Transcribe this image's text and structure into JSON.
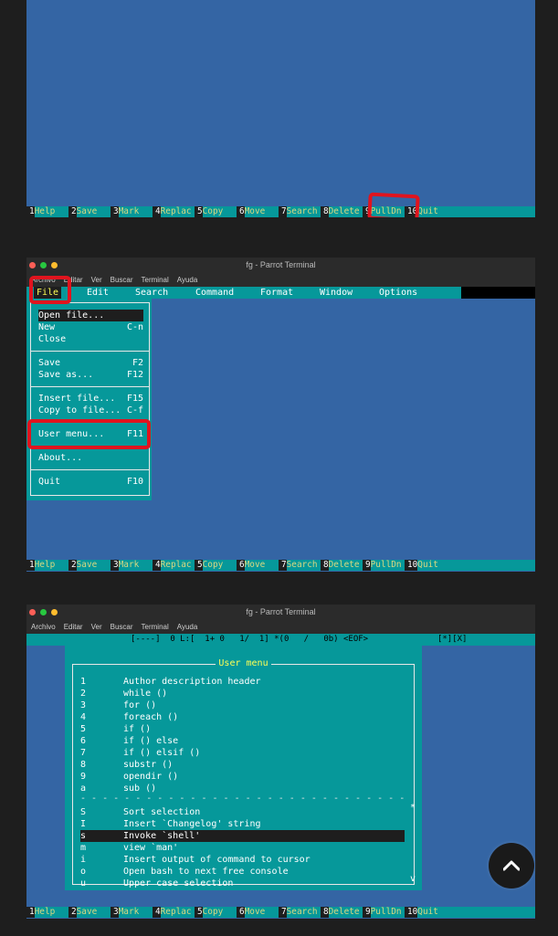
{
  "fkeys": [
    {
      "num": "1",
      "label": "Help"
    },
    {
      "num": "2",
      "label": "Save"
    },
    {
      "num": "3",
      "label": "Mark"
    },
    {
      "num": "4",
      "label": "Replac"
    },
    {
      "num": "5",
      "label": "Copy"
    },
    {
      "num": "6",
      "label": "Move"
    },
    {
      "num": "7",
      "label": "Search"
    },
    {
      "num": "8",
      "label": "Delete"
    },
    {
      "num": "9",
      "label": "PullDn"
    },
    {
      "num": "10",
      "label": "Quit"
    }
  ],
  "window": {
    "title": "fg - Parrot Terminal",
    "dot_colors": [
      "#ff5f57",
      "#28c840",
      "#febc2e"
    ],
    "menus_panel2": [
      "Archivo",
      "Editar",
      "Ver",
      "Buscar",
      "Terminal",
      "Ayuda"
    ],
    "menus_panel3": [
      "Archivo",
      "Editar",
      "Ver",
      "Buscar",
      "Terminal",
      "Ayuda"
    ]
  },
  "mc_menubar": {
    "items": [
      "File",
      "Edit",
      "Search",
      "Command",
      "Format",
      "Window",
      "Options"
    ]
  },
  "file_menu": {
    "items": [
      {
        "label": "Open file...",
        "key": ""
      },
      {
        "label": "New",
        "key": "C-n"
      },
      {
        "label": "Close",
        "key": ""
      },
      {
        "label": "Save",
        "key": "F2"
      },
      {
        "label": "Save as...",
        "key": "F12"
      },
      {
        "label": "Insert file...",
        "key": "F15"
      },
      {
        "label": "Copy to file...",
        "key": "C-f"
      },
      {
        "label": "User menu...",
        "key": "F11"
      },
      {
        "label": "About...",
        "key": ""
      },
      {
        "label": "Quit",
        "key": "F10"
      }
    ]
  },
  "editor_status": "[----]  0 L:[  1+ 0   1/  1] *(0   /   0b) <EOF>              [*][X]",
  "user_menu": {
    "title": "User menu",
    "items": [
      {
        "key": "1",
        "desc": "Author description header"
      },
      {
        "key": "2",
        "desc": "while ()"
      },
      {
        "key": "3",
        "desc": "for ()"
      },
      {
        "key": "4",
        "desc": "foreach ()"
      },
      {
        "key": "5",
        "desc": "if ()"
      },
      {
        "key": "6",
        "desc": "if () else"
      },
      {
        "key": "7",
        "desc": "if () elsif ()"
      },
      {
        "key": "8",
        "desc": "substr ()"
      },
      {
        "key": "9",
        "desc": "opendir ()"
      },
      {
        "key": "a",
        "desc": "sub ()"
      }
    ],
    "items2": [
      {
        "key": "S",
        "desc": "Sort selection"
      },
      {
        "key": "I",
        "desc": "Insert `Changelog' string"
      },
      {
        "key": "s",
        "desc": "Invoke `shell'"
      },
      {
        "key": "m",
        "desc": "view `man'"
      },
      {
        "key": "i",
        "desc": "Insert output of command to cursor"
      },
      {
        "key": "o",
        "desc": "Open bash to next free console"
      },
      {
        "key": "u",
        "desc": "Upper case selection"
      }
    ],
    "scroll_marks": [
      "*",
      "v"
    ]
  },
  "colors": {
    "editor_bg": "#3465a4",
    "bar_cyan": "#06989a",
    "highlight_red": "#e0141e",
    "hotkey_yellow": "#ffff55"
  },
  "icons": {
    "scroll_top": "chevron-up-icon"
  }
}
